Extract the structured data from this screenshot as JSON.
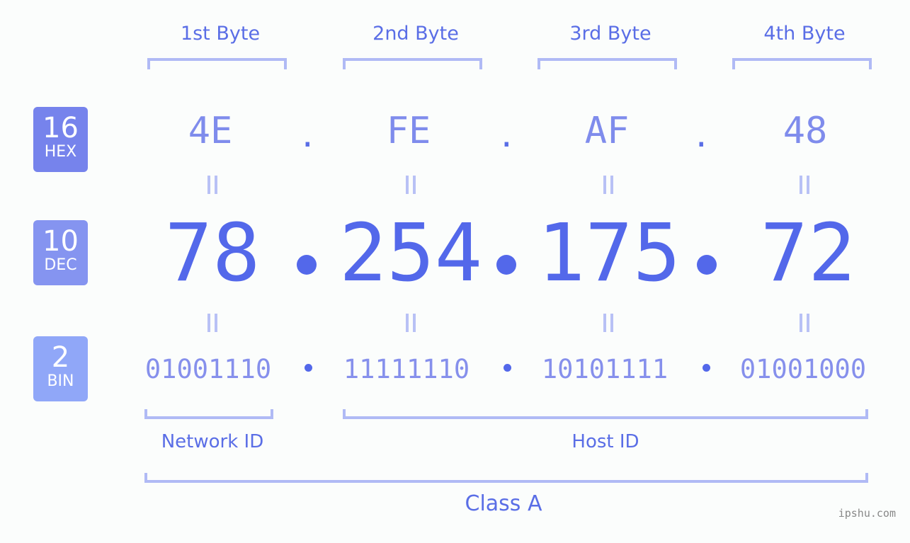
{
  "bytes": {
    "labels": [
      "1st Byte",
      "2nd Byte",
      "3rd Byte",
      "4th Byte"
    ]
  },
  "badges": {
    "hex": {
      "num": "16",
      "label": "HEX",
      "color": "#7683ec"
    },
    "dec": {
      "num": "10",
      "label": "DEC",
      "color": "#8594f0"
    },
    "bin": {
      "num": "2",
      "label": "BIN",
      "color": "#90a7f8"
    }
  },
  "hex": {
    "values": [
      "4E",
      "FE",
      "AF",
      "48"
    ],
    "separator": "."
  },
  "dec": {
    "values": [
      "78",
      "254",
      "175",
      "72"
    ]
  },
  "bin": {
    "values": [
      "01001110",
      "11111110",
      "10101111",
      "01001000"
    ]
  },
  "captions": {
    "network_id": "Network ID",
    "host_id": "Host ID",
    "class": "Class A"
  },
  "watermark": "ipshu.com",
  "colors": {
    "accent": "#5368ea",
    "bracket": "#b0baf5",
    "background": "#fbfdfc"
  }
}
